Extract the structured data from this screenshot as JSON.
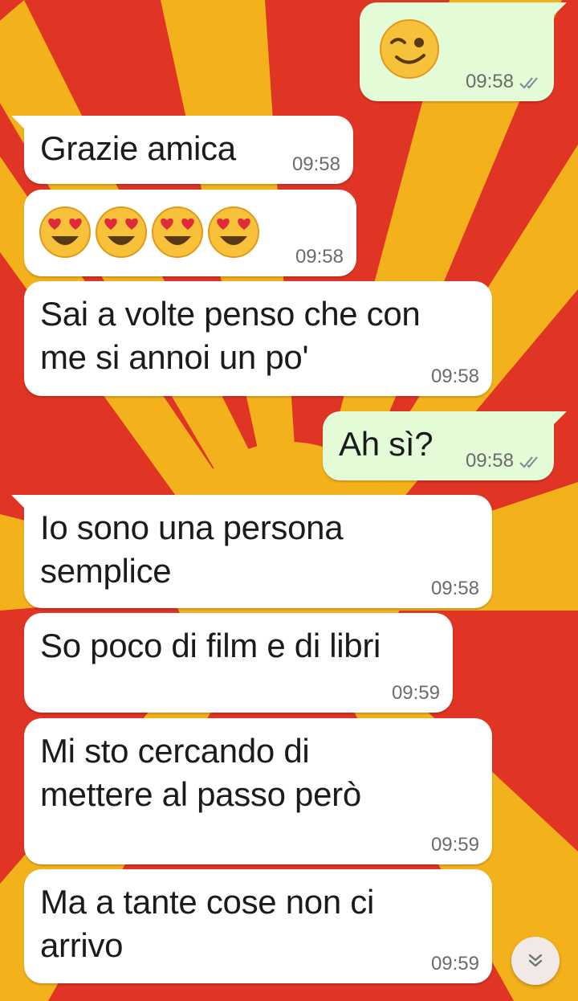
{
  "wallpaper": {
    "description_colors": {
      "red": "#e03425",
      "yellow": "#f3b21c"
    }
  },
  "messages": [
    {
      "id": "m1",
      "direction": "out",
      "emoji": [
        "winking-face"
      ],
      "time": "09:58",
      "status": "read"
    },
    {
      "id": "m2",
      "direction": "in",
      "text": "Grazie amica",
      "time": "09:58"
    },
    {
      "id": "m3",
      "direction": "in",
      "emoji": [
        "heart-eyes-face",
        "heart-eyes-face",
        "heart-eyes-face",
        "heart-eyes-face"
      ],
      "time": "09:58"
    },
    {
      "id": "m4",
      "direction": "in",
      "text": "Sai a volte penso che con\nme si annoi un po'",
      "time": "09:58"
    },
    {
      "id": "m5",
      "direction": "out",
      "text": "Ah sì?",
      "time": "09:58",
      "status": "read"
    },
    {
      "id": "m6",
      "direction": "in",
      "text": "Io sono una persona\nsemplice",
      "time": "09:58"
    },
    {
      "id": "m7",
      "direction": "in",
      "text": "So poco di film e di libri",
      "time": "09:59"
    },
    {
      "id": "m8",
      "direction": "in",
      "text": "Mi sto cercando di\nmettere al passo però",
      "time": "09:59"
    },
    {
      "id": "m9",
      "direction": "in",
      "text": "Ma a tante cose non ci\narrivo",
      "time": "09:59"
    }
  ],
  "scroll_button": {
    "icon": "double-chevron-down-icon"
  },
  "colors": {
    "incoming_bubble": "#ffffff",
    "outgoing_bubble": "#e3fbd6",
    "timestamp": "#6b6b6b",
    "read_ticks": "#7a8a94"
  }
}
